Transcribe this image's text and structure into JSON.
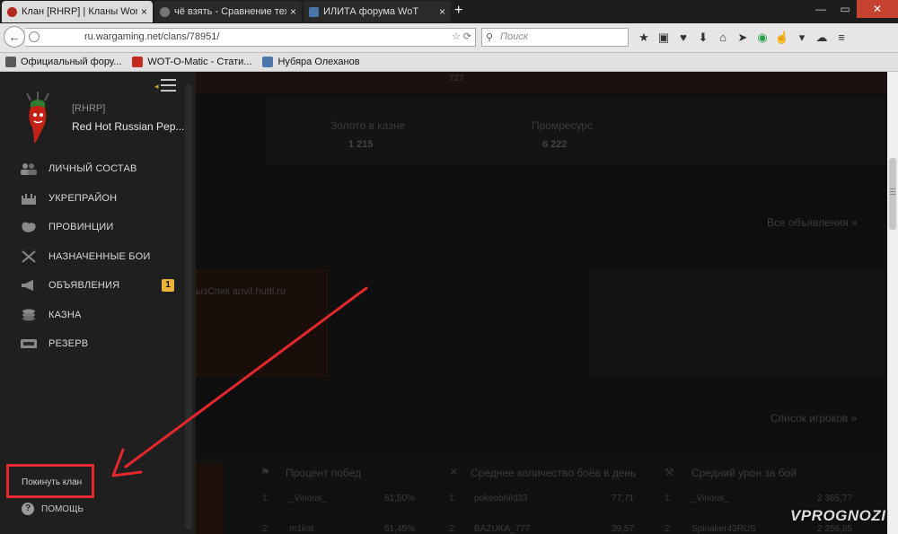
{
  "browser": {
    "tabs": [
      {
        "title": "Клан [RHRP] | Кланы Worl...",
        "favicon_color": "#b52a1f",
        "active": true
      },
      {
        "title": "чё взять - Сравнение техн...",
        "favicon_color": "#777777",
        "active": false
      },
      {
        "title": "ИЛИТА форума WoT",
        "favicon_color": "#4a76a8",
        "active": false
      }
    ],
    "new_tab": "+",
    "window_controls": {
      "minimize": "—",
      "maximize": "▭",
      "close": "✕"
    },
    "url": "ru.wargaming.net/clans/78951/",
    "search_placeholder": "Поиск",
    "bookmarks": [
      {
        "label": "Официальный фору...",
        "color": "#5a5a5a"
      },
      {
        "label": "WOT-O-Matic - Стати...",
        "color": "#c22b1f"
      },
      {
        "label": "Нубяра Олеханов",
        "color": "#4a76a8"
      }
    ]
  },
  "sidebar": {
    "clan_tag": "[RHRP]",
    "clan_name": "Red Hot Russian Pep...",
    "menu": [
      {
        "label": "ЛИЧНЫЙ СОСТАВ",
        "icon": "people-icon"
      },
      {
        "label": "УКРЕПРАЙОН",
        "icon": "fortress-icon"
      },
      {
        "label": "ПРОВИНЦИИ",
        "icon": "map-icon"
      },
      {
        "label": "НАЗНАЧЕННЫЕ БОИ",
        "icon": "crossed-swords-icon"
      },
      {
        "label": "ОБЪЯВЛЕНИЯ",
        "icon": "megaphone-icon",
        "badge": "1"
      },
      {
        "label": "КАЗНА",
        "icon": "coins-icon"
      },
      {
        "label": "РЕЗЕРВ",
        "icon": "reserve-icon"
      }
    ],
    "leave_clan": "Покинуть клан",
    "help": "ПОМОЩЬ",
    "help_icon": "?"
  },
  "content": {
    "top_value": "727",
    "gold_label": "Золото в казне",
    "gold_value": "1 215",
    "industrial_label": "Промресурс",
    "industrial_value": "6 222",
    "all_announcements": "Все объявления »",
    "announcement_text": "ызСпик anvil.hutti.ru",
    "players_list": "Список игроков »",
    "stats": {
      "winrate_title": "Процент побед",
      "battles_title": "Среднее количество боёв в день",
      "damage_title": "Средний урон за бой",
      "winrate_rows": [
        {
          "rank": "1.",
          "name": "_Vinous_",
          "value": "61,50%"
        },
        {
          "rank": "2.",
          "name": "m1kot",
          "value": "61,45%"
        }
      ],
      "battles_rows": [
        {
          "rank": "1.",
          "name": "pokeobhild33",
          "value": "77,71"
        },
        {
          "rank": "2.",
          "name": "BAZUKA_777",
          "value": "39,57"
        }
      ],
      "damage_rows": [
        {
          "rank": "1.",
          "name": "_Vinous_",
          "value": "2 365,77"
        },
        {
          "rank": "2.",
          "name": "Spinaker43RUS",
          "value": "2 256,85"
        }
      ]
    }
  },
  "watermark": "VPROGNOZI",
  "colors": {
    "highlight": "#e4282e",
    "badge": "#e8b53a",
    "sidebar_bg": "#1f1f1f"
  }
}
